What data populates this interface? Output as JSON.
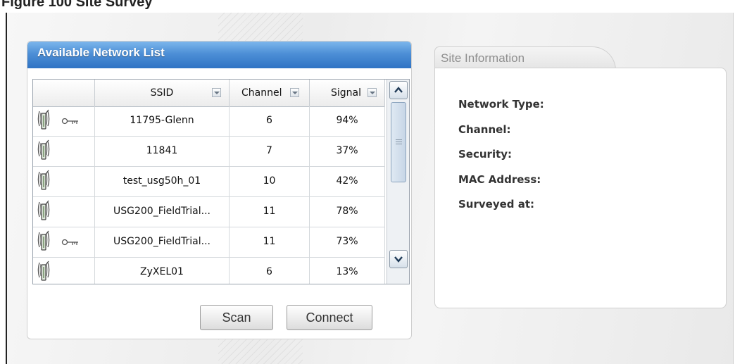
{
  "figure_title": "Figure 100 Site Survey",
  "available_network_list": {
    "title": "Available Network List",
    "columns": [
      "",
      "SSID",
      "Channel",
      "Signal"
    ],
    "rows": [
      {
        "locked": true,
        "ssid": "11795-Glenn",
        "channel": "6",
        "signal": "94%"
      },
      {
        "locked": false,
        "ssid": "11841",
        "channel": "7",
        "signal": "37%"
      },
      {
        "locked": false,
        "ssid": "test_usg50h_01",
        "channel": "10",
        "signal": "42%"
      },
      {
        "locked": false,
        "ssid": "USG200_FieldTrial...",
        "channel": "11",
        "signal": "78%"
      },
      {
        "locked": true,
        "ssid": "USG200_FieldTrial...",
        "channel": "11",
        "signal": "73%"
      },
      {
        "locked": false,
        "ssid": "ZyXEL01",
        "channel": "6",
        "signal": "13%"
      }
    ],
    "buttons": {
      "scan": "Scan",
      "connect": "Connect"
    }
  },
  "site_information": {
    "tab_label": "Site Information",
    "fields": [
      {
        "label": "Network Type:"
      },
      {
        "label": "Channel:"
      },
      {
        "label": "Security:"
      },
      {
        "label": "MAC Address:"
      },
      {
        "label": "Surveyed at:"
      }
    ]
  },
  "icons": {
    "access_point": "access-point-icon",
    "security_key": "key-icon",
    "sort": "sort-arrow-icon",
    "scroll_up": "chevron-up-icon",
    "scroll_down": "chevron-down-icon"
  },
  "colors": {
    "panel_header_blue": "#2f73c4",
    "tab_text": "#8e8e8e"
  }
}
